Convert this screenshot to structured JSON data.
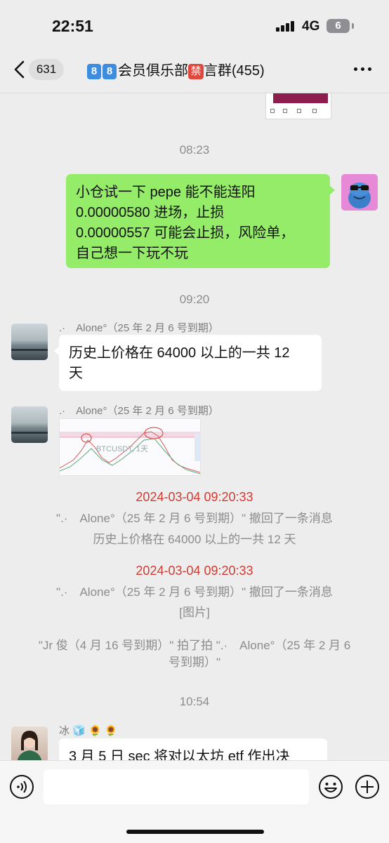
{
  "status": {
    "time": "22:51",
    "network": "4G",
    "battery": "6"
  },
  "nav": {
    "unread": "631",
    "title_prefix": [
      "8",
      "8"
    ],
    "title_main": "会员俱乐部",
    "title_ban": "禁",
    "title_suffix": "言群(455)"
  },
  "messages": {
    "ts1": "08:23",
    "self_text": [
      "小仓试一下 pepe 能不能连阳",
      "0.00000580 进场，止损",
      "0.00000557 可能会止损，风险单，",
      "自己想一下玩不玩"
    ],
    "ts2": "09:20",
    "alone_name": ".·　Alone°（25 年 2 月 6 号到期）",
    "alone_text": [
      "历史上价格在 64000 以上的一共 12",
      "天"
    ],
    "alone_name2": ".·　Alone°（25 年 2 月 6 号到期）",
    "chart_label": "BTCUSDT, 1天",
    "sys1_time": "2024-03-04 09:20:33",
    "sys1_line1": "\".·　Alone°（25 年 2 月 6 号到期）\" 撤回了一条消息",
    "sys1_line2": "历史上价格在 64000 以上的一共 12 天",
    "sys2_time": "2024-03-04 09:20:33",
    "sys2_line1": "\".·　Alone°（25 年 2 月 6 号到期）\" 撤回了一条消息",
    "sys2_line2": "[图片]",
    "pat_line1": "\"Jr 俊（4 月 16 号到期）\" 拍了拍 \".·　Alone°（25 年 2 月 6",
    "pat_line2": "号到期）\"",
    "ts3": "10:54",
    "bing_name": "冰 🧊 🌻 🌻",
    "bing_text": "3 月 5 日 sec 将对以太坊 etf 作出决"
  },
  "icons": {
    "back": "chevron-left-icon",
    "more": "more-dots-icon",
    "voice": "voice-icon",
    "emoji": "emoji-icon",
    "plus": "plus-icon"
  },
  "colors": {
    "self_bubble": "#95ec69",
    "recall_time": "#d33a32",
    "background": "#ededed"
  }
}
